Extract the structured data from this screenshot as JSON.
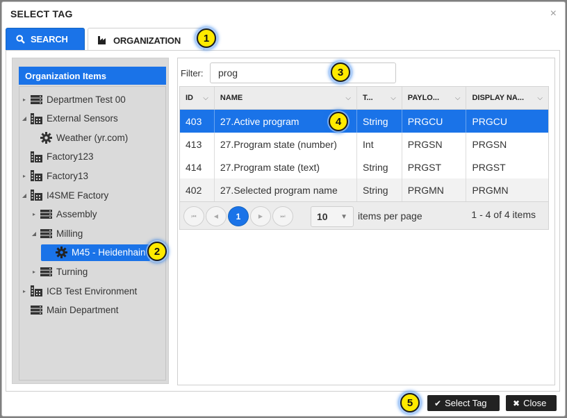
{
  "dialog": {
    "title": "SELECT TAG",
    "close_glyph": "×"
  },
  "tabs": [
    {
      "label": "SEARCH",
      "icon": "search-icon",
      "active": false
    },
    {
      "label": "ORGANIZATION",
      "icon": "factory-icon",
      "active": true
    }
  ],
  "tree": {
    "header": "Organization Items",
    "items": [
      {
        "label": "Departmen Test 00",
        "icon": "server-icon",
        "caret": "▸",
        "level": 0
      },
      {
        "label": "External Sensors",
        "icon": "factory-icon",
        "caret": "◢",
        "level": 0
      },
      {
        "label": "Weather (yr.com)",
        "icon": "gear-icon",
        "caret": "",
        "level": 1
      },
      {
        "label": "Factory123",
        "icon": "factory-icon",
        "caret": "",
        "level": 0
      },
      {
        "label": "Factory13",
        "icon": "factory-icon",
        "caret": "▸",
        "level": 0
      },
      {
        "label": "I4SME Factory",
        "icon": "factory-icon",
        "caret": "◢",
        "level": 0
      },
      {
        "label": "Assembly",
        "icon": "server-icon",
        "caret": "▸",
        "level": 1
      },
      {
        "label": "Milling",
        "icon": "server-icon",
        "caret": "◢",
        "level": 1
      },
      {
        "label": "M45 - Heidenhain",
        "icon": "gear-icon",
        "caret": "",
        "level": 2,
        "selected": true
      },
      {
        "label": "Turning",
        "icon": "server-icon",
        "caret": "▸",
        "level": 1
      },
      {
        "label": "ICB Test Environment",
        "icon": "factory-icon",
        "caret": "▸",
        "level": 0
      },
      {
        "label": "Main Department",
        "icon": "server-icon",
        "caret": "",
        "level": 0
      }
    ]
  },
  "filter": {
    "label": "Filter:",
    "value": "prog"
  },
  "grid": {
    "columns": [
      "ID",
      "NAME",
      "T...",
      "PAYLO...",
      "DISPLAY NA..."
    ],
    "rows": [
      [
        "403",
        "27.Active program",
        "String",
        "PRGCU",
        "PRGCU"
      ],
      [
        "413",
        "27.Program state (number)",
        "Int",
        "PRGSN",
        "PRGSN"
      ],
      [
        "414",
        "27.Program state (text)",
        "String",
        "PRGST",
        "PRGST"
      ],
      [
        "402",
        "27.Selected program name",
        "String",
        "PRGMN",
        "PRGMN"
      ]
    ],
    "selected_row": 0
  },
  "pager": {
    "first": "⏮",
    "prev": "◀",
    "current_page": "1",
    "next": "▶",
    "last": "⏭",
    "page_size": "10",
    "items_per_page_label": "items per page",
    "info": "1 - 4 of 4 items"
  },
  "footer": {
    "select_label": "Select Tag",
    "close_label": "Close"
  },
  "callouts": [
    "1",
    "2",
    "3",
    "4",
    "5"
  ],
  "colors": {
    "accent": "#1a73e8",
    "callout": "#ffea00"
  }
}
